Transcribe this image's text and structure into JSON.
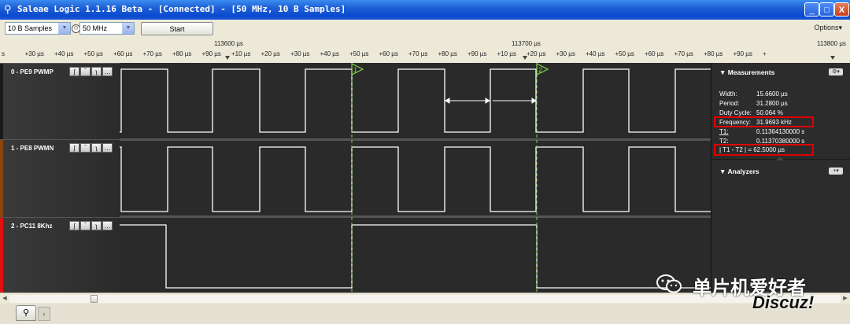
{
  "window": {
    "title": "Saleae Logic 1.1.16 Beta - [Connected] - [50 MHz, 10 B Samples]",
    "app_icon": "magnifier-icon",
    "buttons": {
      "minimize": "_",
      "maximize": "□",
      "close": "X"
    }
  },
  "toolbar": {
    "samples_value": "10 B Samples",
    "speed_value": "50 MHz",
    "start_label": "Start",
    "options_label": "Options▾"
  },
  "timeline": {
    "major_labels": [
      "113600 µs",
      "113700 µs",
      "113800 µs"
    ],
    "minor_labels": [
      "s",
      "+30 µs",
      "+40 µs",
      "+50 µs",
      "+60 µs",
      "+70 µs",
      "+80 µs",
      "+90 µs",
      "+10 µs",
      "+20 µs",
      "+30 µs",
      "+40 µs",
      "+50 µs",
      "+60 µs",
      "+70 µs",
      "+80 µs",
      "+90 µs",
      "+10 µs",
      "+20 µs",
      "+30 µs",
      "+40 µs",
      "+50 µs",
      "+60 µs",
      "+70 µs",
      "+80 µs",
      "+90 µs",
      "+"
    ]
  },
  "channels": [
    {
      "name": "0 - PE9 PWMP",
      "color": "#1a1a1a"
    },
    {
      "name": "1 - PE8 PWMN",
      "color": "#8b4513"
    },
    {
      "name": "2 - PC11 8Khz",
      "color": "#e01010"
    }
  ],
  "channel_controls": [
    "ʃ",
    "‾",
    "ʅ",
    "…"
  ],
  "markers": {
    "t1": "1",
    "t2": "2"
  },
  "measurements": {
    "header": "Measurements",
    "rows": [
      {
        "label": "Width:",
        "value": "15.6600 µs"
      },
      {
        "label": "Period:",
        "value": "31.2800 µs"
      },
      {
        "label": "Duty Cycle:",
        "value": "50.064 %"
      },
      {
        "label": "Frequency:",
        "value": "31.9693 kHz"
      },
      {
        "label": "T1:",
        "value": "0.11364130000 s"
      },
      {
        "label": "T2:",
        "value": "0.11370380000 s"
      }
    ],
    "delta": "| T1 - T2 | = 62.5000 µs"
  },
  "analyzers": {
    "header": "Analyzers",
    "add_label": "+"
  },
  "watermark": {
    "text": "单片机爱好者",
    "site": "Discuz!"
  },
  "accent_colors": {
    "highlight_box": "#e00000",
    "marker": "#7fd34a",
    "signal": "#ffffff"
  }
}
